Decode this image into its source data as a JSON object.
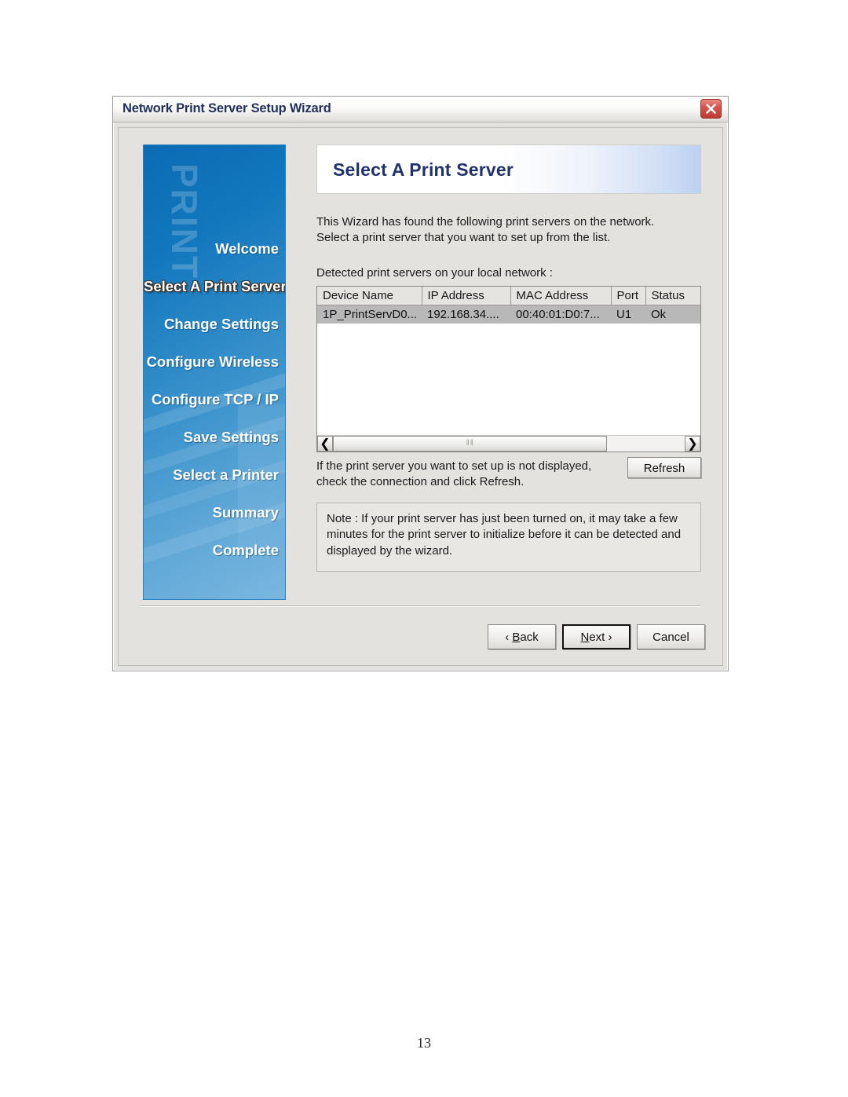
{
  "window": {
    "title": "Network Print Server Setup Wizard",
    "close_icon": "close-icon"
  },
  "sidebar": {
    "watermark": "PRINT",
    "items": [
      {
        "label": "Welcome",
        "active": false
      },
      {
        "label": "Select A Print Server",
        "active": true
      },
      {
        "label": "Change Settings",
        "active": false
      },
      {
        "label": "Configure Wireless",
        "active": false
      },
      {
        "label": "Configure TCP / IP",
        "active": false
      },
      {
        "label": "Save Settings",
        "active": false
      },
      {
        "label": "Select a Printer",
        "active": false
      },
      {
        "label": "Summary",
        "active": false
      },
      {
        "label": "Complete",
        "active": false
      }
    ]
  },
  "panel": {
    "banner_title": "Select A Print Server",
    "intro_text": "This Wizard has found the following print servers on the network.\nSelect a print server that you want to set up from the list.",
    "detected_label": "Detected print servers on your local network :",
    "table": {
      "columns": [
        "Device Name",
        "IP Address",
        "MAC Address",
        "Port",
        "Status"
      ],
      "rows": [
        {
          "selected": true,
          "cells": [
            "1P_PrintServD0...",
            "192.168.34....",
            "00:40:01:D0:7...",
            "U1",
            "Ok"
          ]
        }
      ]
    },
    "scrollbar": {
      "left_arrow": "❮",
      "right_arrow": "❯",
      "grip": "‖‖"
    },
    "refresh_hint": "If the print server you want to set up is not displayed,\ncheck the connection and click Refresh.",
    "refresh_label": "Refresh",
    "note_text": "Note : If your print server has just been turned on, it may take a few minutes for the print server to initialize before it can be detected and displayed by the wizard."
  },
  "footer": {
    "back_pre": "‹ ",
    "back_accel": "B",
    "back_post": "ack",
    "next_accel": "N",
    "next_post": "ext ›",
    "cancel_label": "Cancel"
  },
  "document": {
    "page_number": "13"
  },
  "colors": {
    "sidebar_top": "#0b6cb4",
    "sidebar_bottom": "#7ab7df",
    "banner_text": "#21316b",
    "title_text": "#21315c",
    "close_button": "#d9534d",
    "selection": "#b8b8b8",
    "dialog_face": "#e4e2de"
  }
}
